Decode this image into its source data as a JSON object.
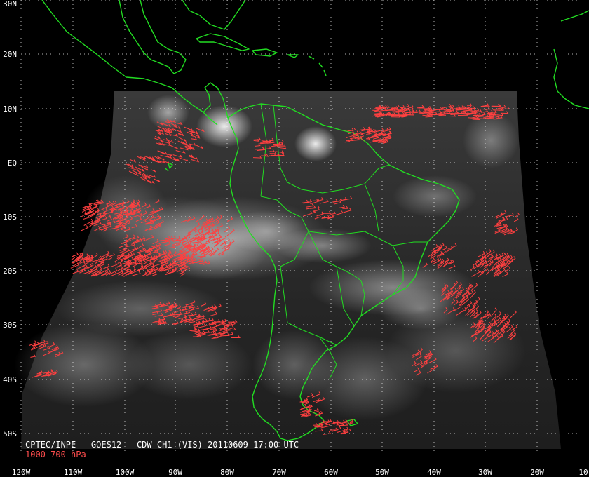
{
  "map": {
    "caption_line1": "CPTEC/INPE - GOES12 - CDW CH1 (VIS) 20110609 17:00 UTC",
    "caption_line2": "1000-700 hPa",
    "latitude_labels": [
      "30N",
      "20N",
      "10N",
      "EQ",
      "10S",
      "20S",
      "30S",
      "40S",
      "50S"
    ],
    "longitude_labels": [
      "120W",
      "110W",
      "100W",
      "90W",
      "80W",
      "70W",
      "60W",
      "50W",
      "40W",
      "30W",
      "20W",
      "10"
    ],
    "colors": {
      "background": "#000000",
      "coastline": "#22dd22",
      "wind_vectors": "#ff4040",
      "graticule": "#ffffff",
      "clouds": "#e6e6e6"
    },
    "projection": "cylindrical",
    "grid": true
  }
}
